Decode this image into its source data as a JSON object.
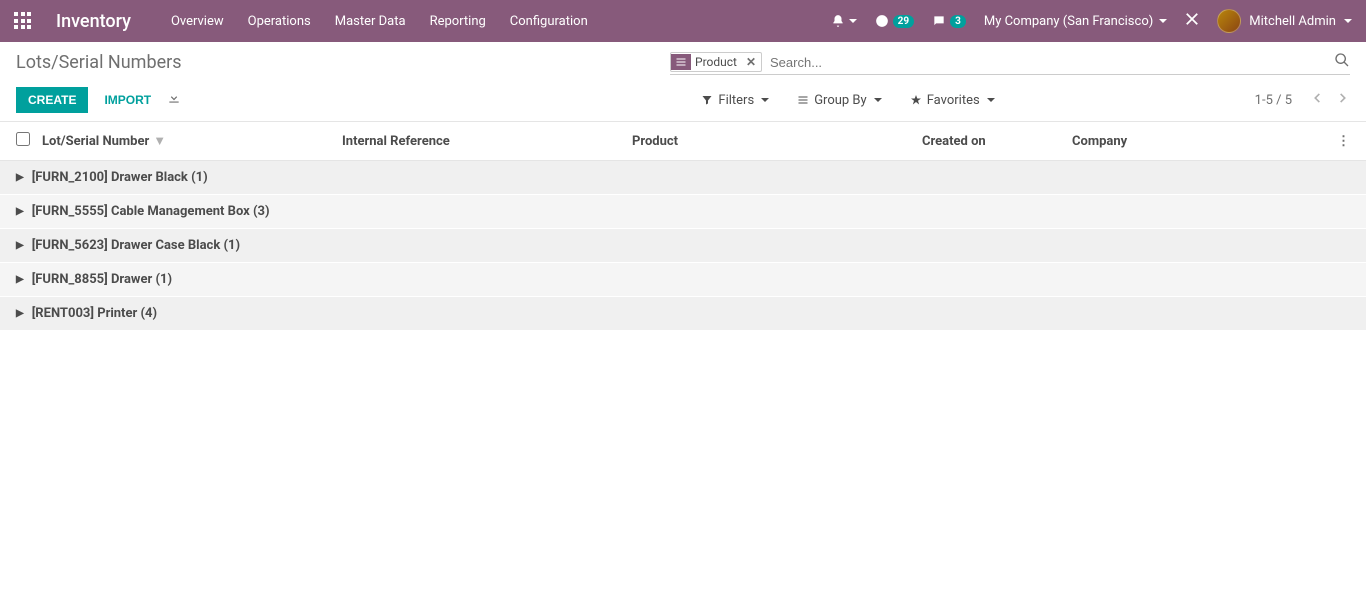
{
  "topbar": {
    "brand": "Inventory",
    "menu": [
      "Overview",
      "Operations",
      "Master Data",
      "Reporting",
      "Configuration"
    ],
    "clock_badge": "29",
    "chat_badge": "3",
    "company": "My Company (San Francisco)",
    "user": "Mitchell Admin"
  },
  "control": {
    "title": "Lots/Serial Numbers",
    "create": "CREATE",
    "import": "IMPORT",
    "search_facet": "Product",
    "search_placeholder": "Search...",
    "filters": "Filters",
    "group_by": "Group By",
    "favorites": "Favorites",
    "pager": "1-5 / 5"
  },
  "columns": {
    "lot": "Lot/Serial Number",
    "ref": "Internal Reference",
    "product": "Product",
    "created": "Created on",
    "company": "Company"
  },
  "groups": [
    {
      "label": "[FURN_2100] Drawer Black (1)"
    },
    {
      "label": "[FURN_5555] Cable Management Box (3)"
    },
    {
      "label": "[FURN_5623] Drawer Case Black (1)"
    },
    {
      "label": "[FURN_8855] Drawer (1)"
    },
    {
      "label": "[RENT003] Printer (4)"
    }
  ]
}
